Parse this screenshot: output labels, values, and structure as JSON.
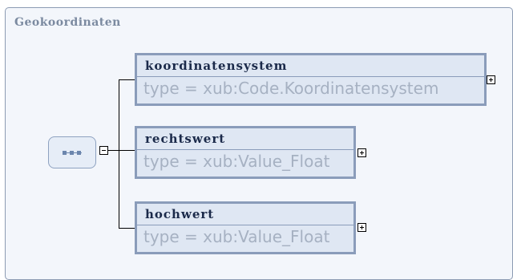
{
  "diagram": {
    "group_title": "Geokoordinaten",
    "elements": [
      {
        "name": "koordinatensystem",
        "type": "type = xub:Code.Koordinatensystem"
      },
      {
        "name": "rechtswert",
        "type": "type = xub:Value_Float"
      },
      {
        "name": "hochwert",
        "type": "type = xub:Value_Float"
      }
    ]
  }
}
